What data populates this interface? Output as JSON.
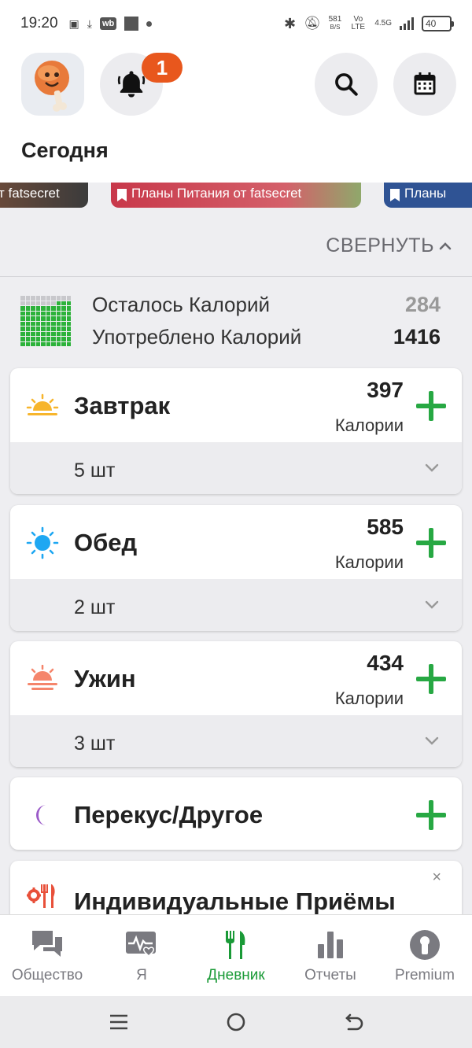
{
  "status_bar": {
    "time": "19:20",
    "net_speed": "581",
    "net_unit": "B/S",
    "network_type": "Vo LTE",
    "network_gen": "4.5G",
    "battery": "40"
  },
  "header": {
    "notification_count": "1",
    "title": "Сегодня"
  },
  "banners": [
    {
      "text": "т fatsecret"
    },
    {
      "text": "Планы Питания от fatsecret"
    },
    {
      "text": "Планы"
    }
  ],
  "collapse_label": "СВЕРНУТЬ",
  "calories": {
    "remaining_label": "Осталось Калорий",
    "remaining_value": "284",
    "used_label": "Употреблено Калорий",
    "used_value": "1416",
    "progress_fraction": 0.83
  },
  "meals": [
    {
      "name": "Завтрак",
      "calories": "397",
      "unit": "Калории",
      "count": "5 шт",
      "icon": "sunrise-icon"
    },
    {
      "name": "Обед",
      "calories": "585",
      "unit": "Калории",
      "count": "2 шт",
      "icon": "sun-icon"
    },
    {
      "name": "Ужин",
      "calories": "434",
      "unit": "Калории",
      "count": "3 шт",
      "icon": "sunset-icon"
    },
    {
      "name": "Перекус/Другое",
      "icon": "moon-icon"
    }
  ],
  "custom_meals": {
    "title": "Индивидуальные Приёмы",
    "close": "×"
  },
  "bottom_nav": [
    {
      "label": "Общество",
      "icon": "chat-icon"
    },
    {
      "label": "Я",
      "icon": "heart-pulse-icon"
    },
    {
      "label": "Дневник",
      "icon": "fork-knife-icon",
      "active": true
    },
    {
      "label": "Отчеты",
      "icon": "bar-chart-icon"
    },
    {
      "label": "Premium",
      "icon": "premium-icon"
    }
  ],
  "colors": {
    "accent_green": "#27a843",
    "badge_orange": "#e8571d",
    "active_nav": "#1a9a37"
  }
}
